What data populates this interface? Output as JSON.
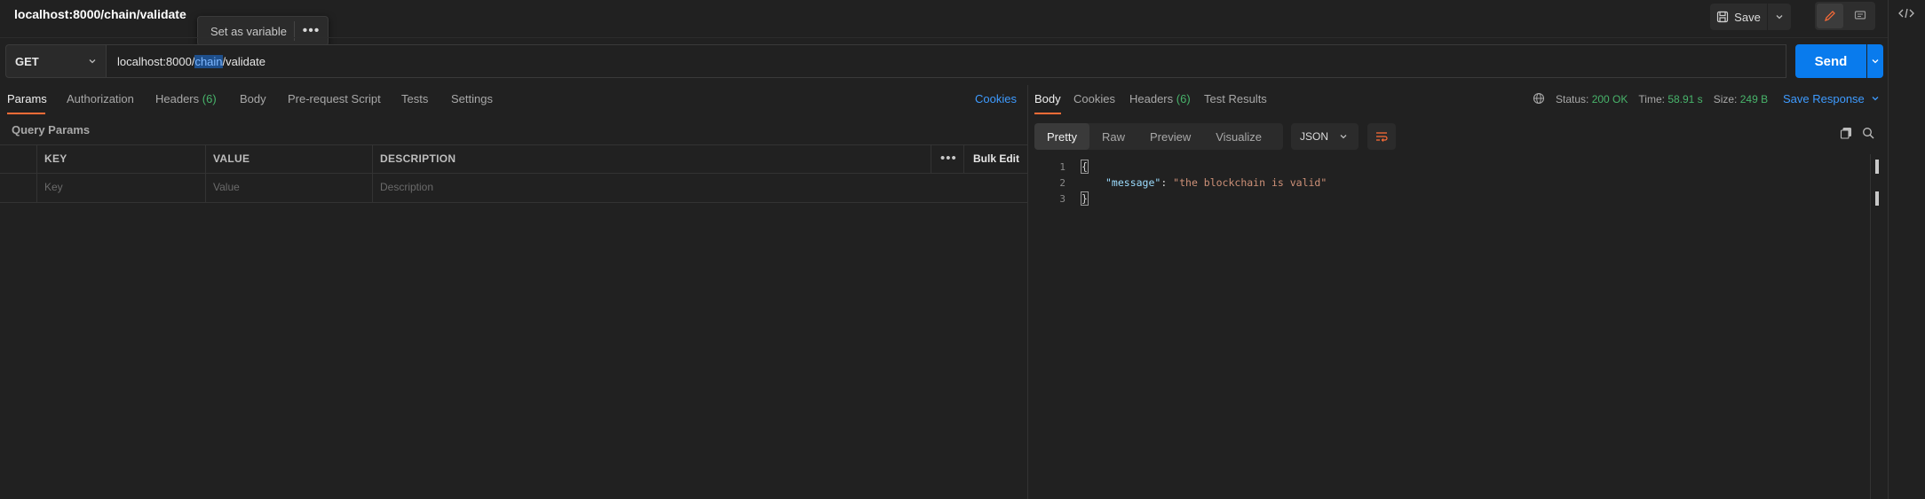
{
  "tab": {
    "title": "localhost:8000/chain/validate"
  },
  "popover": {
    "label": "Set as variable",
    "more": "•••"
  },
  "toolbar": {
    "save_label": "Save"
  },
  "request": {
    "method": "GET",
    "url_prefix": "localhost:8000/",
    "url_selected": "chain",
    "url_suffix": "/validate",
    "send_label": "Send"
  },
  "request_tabs": {
    "params": "Params",
    "authorization": "Authorization",
    "headers": "Headers",
    "headers_count": "(6)",
    "body": "Body",
    "prerequest": "Pre-request Script",
    "tests": "Tests",
    "settings": "Settings",
    "cookies": "Cookies"
  },
  "query_params": {
    "title": "Query Params",
    "columns": {
      "key": "KEY",
      "value": "VALUE",
      "description": "DESCRIPTION"
    },
    "more": "•••",
    "bulk_edit": "Bulk Edit",
    "placeholders": {
      "key": "Key",
      "value": "Value",
      "description": "Description"
    }
  },
  "response_tabs": {
    "body": "Body",
    "cookies": "Cookies",
    "headers": "Headers",
    "headers_count": "(6)",
    "test_results": "Test Results"
  },
  "response_meta": {
    "status_label": "Status:",
    "status_value": "200 OK",
    "time_label": "Time:",
    "time_value": "58.91 s",
    "size_label": "Size:",
    "size_value": "249 B",
    "save_response": "Save Response"
  },
  "view_modes": {
    "pretty": "Pretty",
    "raw": "Raw",
    "preview": "Preview",
    "visualize": "Visualize"
  },
  "format": "JSON",
  "response_body": {
    "lines": [
      "1",
      "2",
      "3"
    ],
    "open_brace": "{",
    "key": "\"message\"",
    "colon": ": ",
    "value": "\"the blockchain is valid\"",
    "close_brace": "}"
  },
  "colors": {
    "accent": "#ff6c37",
    "send": "#097bed",
    "link": "#3e9bff",
    "ok": "#48b46b"
  }
}
